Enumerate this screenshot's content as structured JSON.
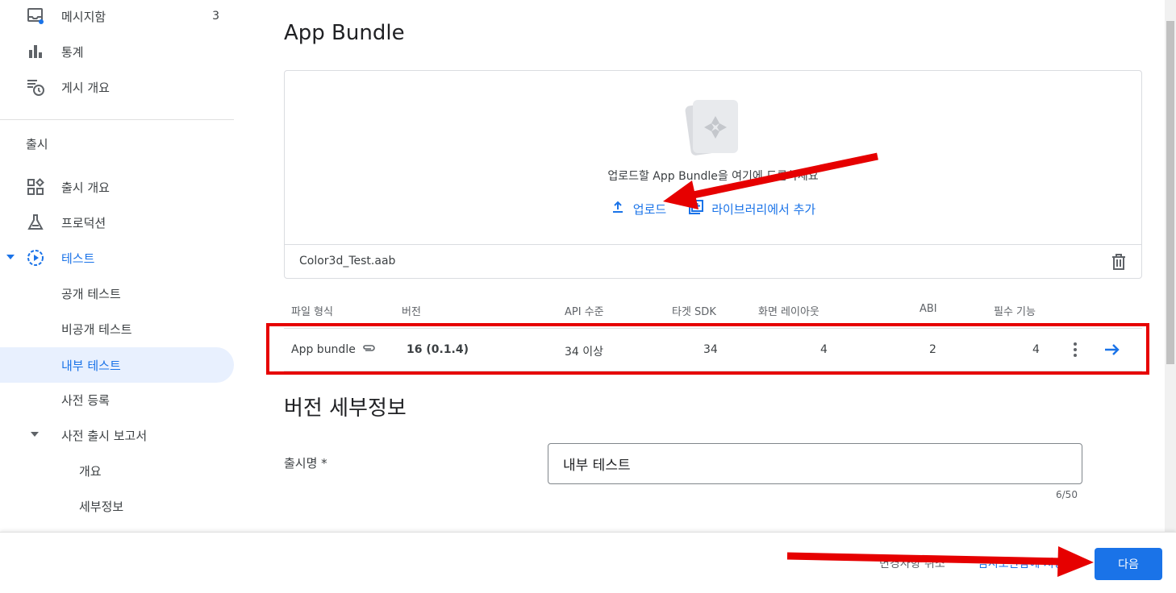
{
  "sidebar": {
    "items_top": [
      {
        "label": "메시지함",
        "badge": "3",
        "icon": "inbox-icon"
      },
      {
        "label": "통계",
        "icon": "bar-chart-icon"
      },
      {
        "label": "게시 개요",
        "icon": "publishing-overview-icon"
      }
    ],
    "section_label": "출시",
    "release_items": [
      {
        "label": "출시 개요",
        "icon": "dashboard-icon"
      },
      {
        "label": "프로덕션",
        "icon": "flask-icon"
      },
      {
        "label": "테스트",
        "icon": "play-circle-icon"
      },
      {
        "label": "공개 테스트"
      },
      {
        "label": "비공개 테스트"
      },
      {
        "label": "내부 테스트"
      },
      {
        "label": "사전 등록"
      },
      {
        "label": "사전 출시 보고서"
      },
      {
        "label": "개요"
      },
      {
        "label": "세부정보"
      }
    ]
  },
  "main": {
    "title": "App Bundle",
    "upload": {
      "hint": "업로드할 App Bundle을 여기에 드롭하세요",
      "upload_label": "업로드",
      "library_label": "라이브러리에서 추가",
      "file_name": "Color3d_Test.aab"
    },
    "table": {
      "headers": [
        "파일 형식",
        "버전",
        "API 수준",
        "타겟 SDK",
        "화면 레이아웃",
        "ABI",
        "필수 기능"
      ],
      "row": {
        "file_type": "App bundle",
        "version": "16 (0.1.4)",
        "api_level": "34 이상",
        "target_sdk": "34",
        "screen_layouts": "4",
        "abi": "2",
        "required_features": "4"
      }
    },
    "details_title": "버전 세부정보",
    "release_name_label": "출시명 *",
    "release_name_value": "내부 테스트",
    "char_counter": "6/50"
  },
  "footer": {
    "discard_label": "변경사항 취소",
    "save_label": "임시보관함에 저장",
    "next_label": "다음"
  },
  "colors": {
    "accent": "#1a73e8",
    "annotation": "#e60000"
  }
}
